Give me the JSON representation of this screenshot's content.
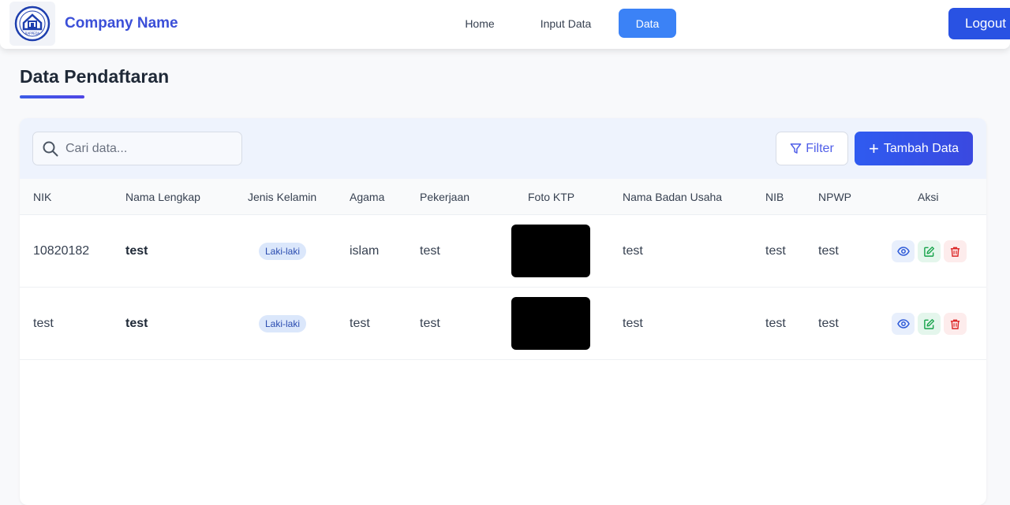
{
  "navbar": {
    "brand": "Company Name",
    "links": [
      "Home",
      "Input Data",
      "Data"
    ],
    "active": "Data",
    "logout_label": "Logout"
  },
  "page": {
    "title": "Data Pendaftaran"
  },
  "toolbar": {
    "search_placeholder": "Cari data...",
    "filter_label": "Filter",
    "add_label": "Tambah Data"
  },
  "table": {
    "columns": [
      "NIK",
      "Nama Lengkap",
      "Jenis Kelamin",
      "Agama",
      "Pekerjaan",
      "Foto KTP",
      "Nama Badan Usaha",
      "NIB",
      "NPWP",
      "Aksi"
    ],
    "rows": [
      {
        "nik": "10820182",
        "nama": "test",
        "jenis_kelamin": "Laki-laki",
        "agama": "islam",
        "pekerjaan": "test",
        "badan_usaha": "test",
        "nib": "test",
        "npwp": "test"
      },
      {
        "nik": "test",
        "nama": "test",
        "jenis_kelamin": "Laki-laki",
        "agama": "test",
        "pekerjaan": "test",
        "badan_usaha": "test",
        "nib": "test",
        "npwp": "test"
      }
    ]
  },
  "colors": {
    "brand": "#3b4fd8",
    "nav_active": "#3b82f6",
    "primary_button": "#2f5bf0",
    "view_icon": "#2f5bd8",
    "edit_icon": "#16a34a",
    "delete_icon": "#dc2626"
  },
  "icons": {
    "logo": "company-logo",
    "search": "search-icon",
    "filter": "filter-icon",
    "add": "plus-icon",
    "view": "eye-icon",
    "edit": "edit-icon",
    "delete": "trash-icon"
  }
}
